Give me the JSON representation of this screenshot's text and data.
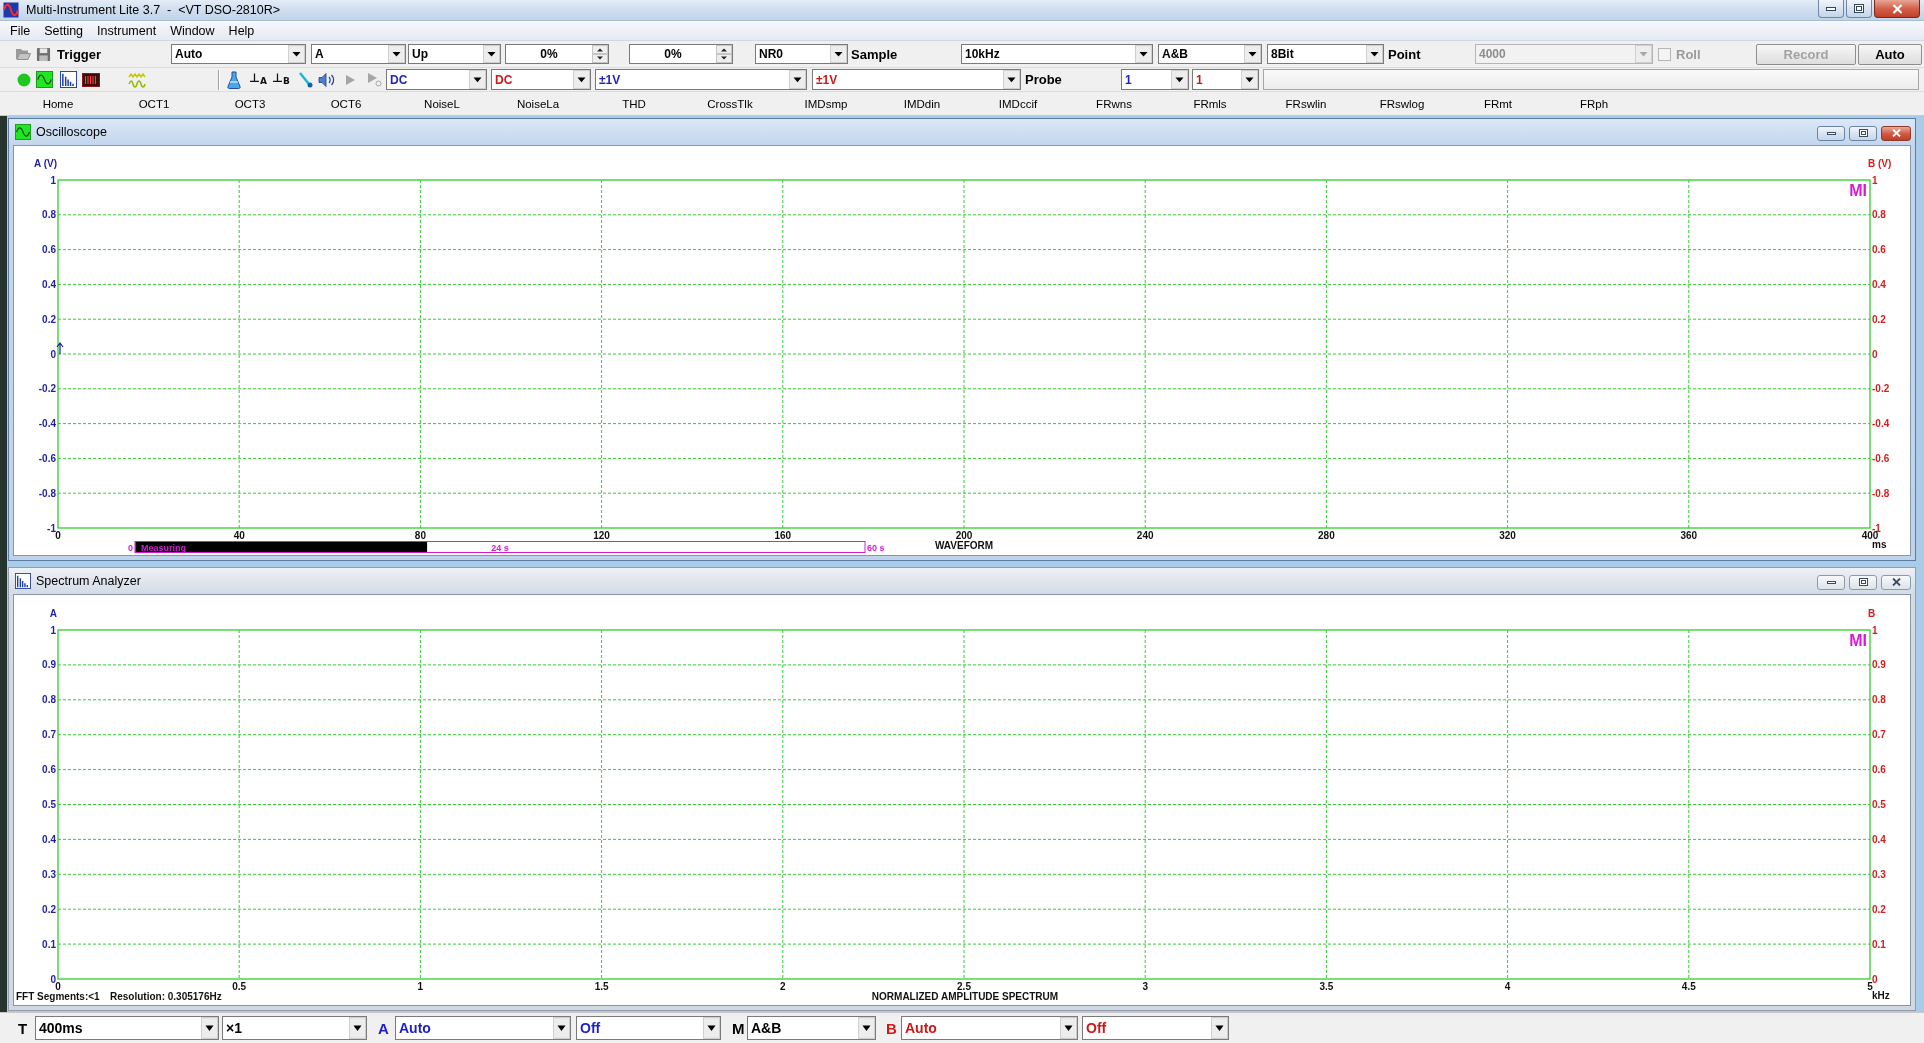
{
  "window": {
    "title": "Multi-Instrument Lite 3.7  -  <VT DSO-2810R>"
  },
  "menu": [
    "File",
    "Setting",
    "Instrument",
    "Window",
    "Help"
  ],
  "toolbar_top": [
    {
      "kind": "label",
      "text": "Trigger",
      "disabled": false
    },
    {
      "kind": "combo",
      "value": "Auto",
      "disabled": false
    },
    {
      "kind": "combo",
      "value": "A",
      "disabled": false
    },
    {
      "kind": "combo",
      "value": "Up",
      "disabled": false
    },
    {
      "kind": "spinner",
      "value": "0%",
      "disabled": false
    },
    {
      "kind": "spinner",
      "value": "0%",
      "disabled": false
    },
    {
      "kind": "combo",
      "value": "NR0",
      "disabled": false
    },
    {
      "kind": "label",
      "text": "Sample",
      "disabled": false
    },
    {
      "kind": "combo",
      "value": "10kHz",
      "disabled": false
    },
    {
      "kind": "combo",
      "value": "A&B",
      "disabled": false
    },
    {
      "kind": "combo",
      "value": "8Bit",
      "disabled": false
    },
    {
      "kind": "label",
      "text": "Point",
      "disabled": false
    },
    {
      "kind": "combo",
      "value": "4000",
      "disabled": true
    },
    {
      "kind": "checkbox",
      "label": "Roll",
      "checked": false,
      "disabled": true
    },
    {
      "kind": "button",
      "label": "Record",
      "disabled": true
    },
    {
      "kind": "button",
      "label": "Auto",
      "disabled": false
    }
  ],
  "toolbar_channel": {
    "player_disabled": true,
    "offset_buttons": [
      "⊥$_{A}$",
      "⊥$_{B}$"
    ],
    "controls": [
      {
        "kind": "combo",
        "value": "DC",
        "color": "#1f1fc8"
      },
      {
        "kind": "combo",
        "value": "DC",
        "color": "#d01818"
      },
      {
        "kind": "combo",
        "value": "±1V",
        "color": "#1f1fc8"
      },
      {
        "kind": "combo",
        "value": "±1V",
        "color": "#d01818"
      },
      {
        "kind": "label",
        "text": "Probe",
        "color": "#000000"
      },
      {
        "kind": "combo",
        "value": "1",
        "color": "#1f1fc8"
      },
      {
        "kind": "combo",
        "value": "1",
        "color": "#d01818"
      }
    ]
  },
  "shortcuts": [
    "Home",
    "OCT1",
    "OCT3",
    "OCT6",
    "NoiseL",
    "NoiseLa",
    "THD",
    "CrossTlk",
    "IMDsmp",
    "IMDdin",
    "IMDccif",
    "FRwns",
    "FRmls",
    "FRswlin",
    "FRswlog",
    "FRmt",
    "FRph"
  ],
  "oscilloscope": {
    "title": "Oscilloscope",
    "active": true,
    "logo": "MI",
    "chart_data": {
      "type": "line",
      "title": "WAVEFORM",
      "xlabel": "ms",
      "ylabel": "A (V)",
      "y2label": "B (V)",
      "grid": true,
      "xlim": [
        0,
        400
      ],
      "ylim": [
        -1,
        1
      ],
      "y2lim": [
        -1,
        1
      ],
      "xticks": [
        0,
        40,
        80,
        120,
        160,
        200,
        240,
        280,
        320,
        360,
        400
      ],
      "yticks": [
        -1,
        -0.8,
        -0.6,
        -0.4,
        -0.2,
        0,
        0.2,
        0.4,
        0.6,
        0.8,
        1
      ],
      "y2ticks": [
        -1,
        -0.8,
        -0.6,
        -0.4,
        -0.2,
        0,
        0.2,
        0.4,
        0.6,
        0.8,
        1
      ]
    },
    "progress": {
      "start_label": "0",
      "label": "Measuring",
      "reading": "24 s",
      "end_label": "60 s",
      "level": 0.4
    }
  },
  "spectrum_analyzer": {
    "title": "Spectrum Analyzer",
    "active": false,
    "logo": "MI",
    "chart_data": {
      "type": "line",
      "title": "NORMALIZED AMPLITUDE SPECTRUM",
      "xlabel": "kHz",
      "ylabel": "A",
      "y2label": "B",
      "grid": true,
      "xlim": [
        0,
        5
      ],
      "ylim": [
        0,
        1
      ],
      "y2lim": [
        0,
        1
      ],
      "xticks": [
        0,
        0.5,
        1,
        1.5,
        2,
        2.5,
        3,
        3.5,
        4,
        4.5,
        5
      ],
      "yticks": [
        0,
        0.1,
        0.2,
        0.3,
        0.4,
        0.5,
        0.6,
        0.7,
        0.8,
        0.9,
        1
      ],
      "y2ticks": [
        0,
        0.1,
        0.2,
        0.3,
        0.4,
        0.5,
        0.6,
        0.7,
        0.8,
        0.9,
        1
      ]
    },
    "notes": [
      "FFT Segments:<1",
      "Resolution: 0.305176Hz"
    ]
  },
  "bottom_toolbar": [
    {
      "kind": "label",
      "text": "T",
      "color": "#000000"
    },
    {
      "kind": "combo",
      "value": "400ms",
      "color": "#000000"
    },
    {
      "kind": "combo",
      "value": "×1",
      "color": "#000000"
    },
    {
      "kind": "label",
      "text": "A",
      "color": "#1f1fc8"
    },
    {
      "kind": "combo",
      "value": "Auto",
      "color": "#1f1fc8"
    },
    {
      "kind": "combo",
      "value": "Off",
      "color": "#1f1fc8"
    },
    {
      "kind": "label",
      "text": "M",
      "color": "#000000"
    },
    {
      "kind": "combo",
      "value": "A&B",
      "color": "#000000"
    },
    {
      "kind": "label",
      "text": "B",
      "color": "#d01818"
    },
    {
      "kind": "combo",
      "value": "Auto",
      "color": "#d01818"
    },
    {
      "kind": "combo",
      "value": "Off",
      "color": "#d01818"
    }
  ]
}
